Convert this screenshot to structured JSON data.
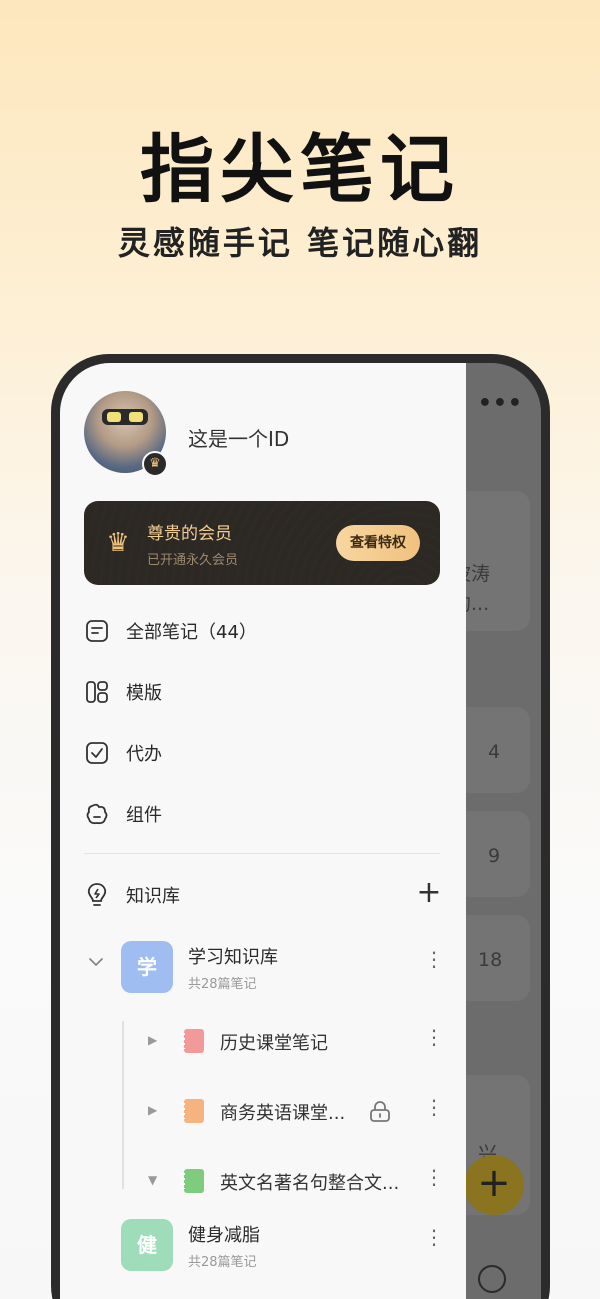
{
  "hero": {
    "title": "指尖笔记",
    "subtitle": "灵感随手记  笔记随心翻"
  },
  "background_app": {
    "more": "•••",
    "texts": [
      "波涛",
      "的...",
      "4",
      "9",
      "18",
      "兴"
    ],
    "fab": "+"
  },
  "drawer": {
    "user": {
      "name": "这是一个ID"
    },
    "vip": {
      "title": "尊贵的会员",
      "subtitle": "已开通永久会员",
      "button": "查看特权"
    },
    "menu": [
      {
        "label": "全部笔记（44）",
        "icon": "notes-icon"
      },
      {
        "label": "模版",
        "icon": "template-icon"
      },
      {
        "label": "代办",
        "icon": "todo-icon"
      },
      {
        "label": "组件",
        "icon": "widget-icon"
      }
    ],
    "knowledge": {
      "label": "知识库",
      "add": "+"
    },
    "kb_items": [
      {
        "badge": "学",
        "title": "学习知识库",
        "subtitle": "共28篇笔记",
        "color": "#9fbdf0"
      },
      {
        "badge": "健",
        "title": "健身减脂",
        "subtitle": "共28篇笔记",
        "color": "#9fdcb9"
      }
    ],
    "notes": [
      {
        "label": "历史课堂笔记",
        "color": "#f29a9a"
      },
      {
        "label": "商务英语课堂...",
        "color": "#f5b47f",
        "locked": true
      },
      {
        "label": "英文名著名句整合文...",
        "color": "#7fcc7f"
      }
    ]
  }
}
